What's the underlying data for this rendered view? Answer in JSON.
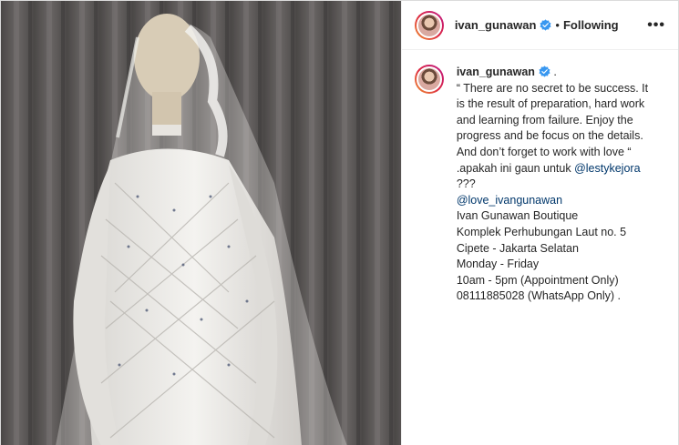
{
  "post": {
    "username": "ivan_gunawan",
    "separator": "•",
    "follow_label": "Following",
    "more_label": "•••"
  },
  "caption": {
    "username": "ivan_gunawan",
    "after_name": " .",
    "lines": [
      "“ There are no secret to be success. It",
      "is the result of preparation, hard work",
      "and learning from failure. Enjoy the",
      "progress and be focus on the details.",
      "And don’t forget to work with love “"
    ],
    "apakah_prefix": ".apakah ini gaun untuk ",
    "mention_lesty": "@lestykejora",
    "question": "???",
    "mention_love": "@love_ivangunawan",
    "address_lines": [
      "Ivan Gunawan Boutique",
      "Komplek Perhubungan Laut no. 5",
      "Cipete - Jakarta Selatan",
      "Monday - Friday",
      "10am - 5pm (Appointment Only)",
      "08111885028 (WhatsApp Only) ."
    ]
  },
  "colors": {
    "link": "#00376b",
    "verified": "#3897f0",
    "text": "#262626"
  },
  "icons": {
    "verified": "verified-badge-icon",
    "more": "more-options-icon"
  }
}
